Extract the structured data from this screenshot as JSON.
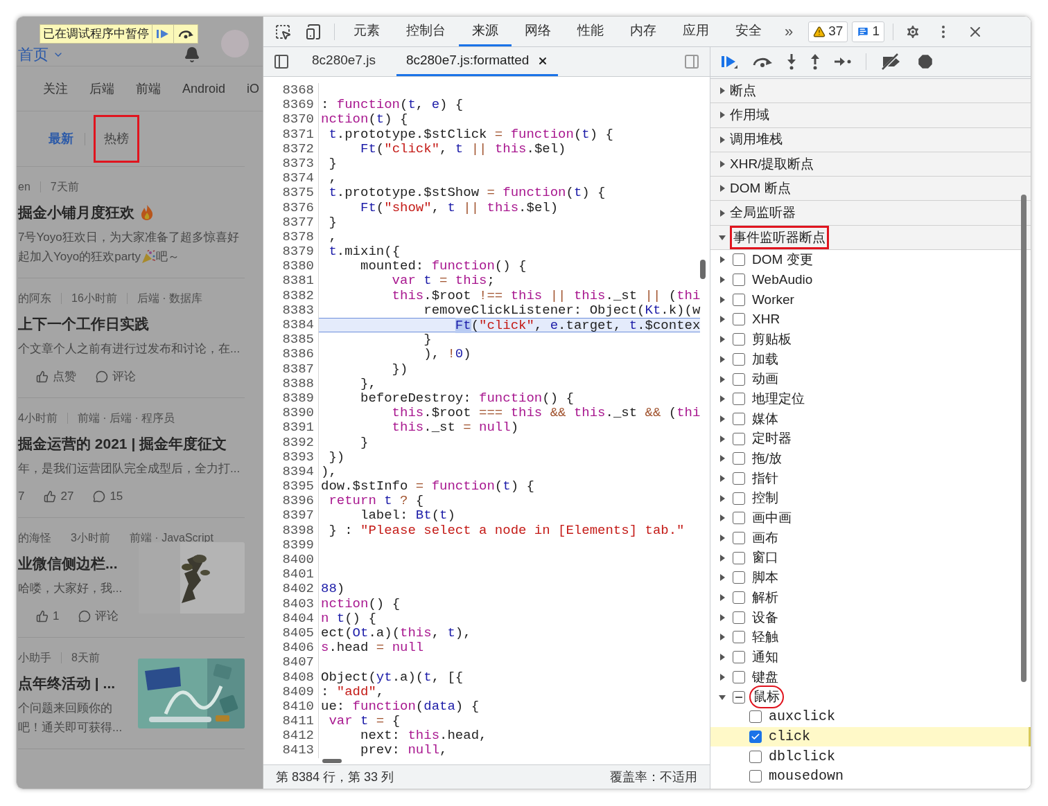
{
  "page": {
    "paused_banner": {
      "text": "已在调试程序中暂停"
    },
    "home": "首页",
    "nav": [
      "关注",
      "后端",
      "前端",
      "Android",
      "iO"
    ],
    "tabs": [
      {
        "label": "最新",
        "selected": true,
        "annotated": false
      },
      {
        "label": "热榜",
        "selected": false,
        "annotated": true
      }
    ],
    "articles": [
      {
        "meta": [
          "en",
          "7天前"
        ],
        "title": "掘金小铺月度狂欢",
        "title_emoji": true,
        "thumbnail": false,
        "lines": [
          [
            {
              "kind": "text",
              "text": "7号Yoyo狂欢日，为大家准备了超多惊喜好"
            }
          ],
          [
            {
              "kind": "text",
              "text": "起加入Yoyo的狂欢party"
            },
            {
              "kind": "party-icon"
            },
            {
              "kind": "text",
              "text": "吧～"
            }
          ]
        ]
      },
      {
        "meta": [
          "的阿东",
          "16小时前",
          "后端 · 数据库"
        ],
        "title": "上下一个工作日实践",
        "title_emoji": false,
        "thumbnail": false,
        "lines": [
          [
            {
              "kind": "text",
              "text": "个文章个人之前有进行过发布和讨论，在..."
            }
          ]
        ],
        "stats": [
          {
            "kind": "like",
            "label": "点赞"
          },
          {
            "kind": "comment",
            "label": "评论"
          }
        ]
      },
      {
        "meta": [
          "4小时前",
          "前端 · 后端 · 程序员"
        ],
        "title": "掘金运营的 2021 | 掘金年度征文",
        "title_emoji": false,
        "thumbnail": false,
        "lines": [
          [
            {
              "kind": "text",
              "text": "年，是我们运营团队完全成型后，全力打..."
            }
          ]
        ],
        "stats": [
          {
            "kind": "plain",
            "label": "7"
          },
          {
            "kind": "like",
            "label": "27"
          },
          {
            "kind": "comment",
            "label": "15"
          }
        ]
      },
      {
        "meta": [
          "的海怪",
          "3小时前",
          "前端 · JavaScript"
        ],
        "title": "业微信侧边栏...",
        "title_emoji": false,
        "thumbnail": true,
        "lines": [
          [
            {
              "kind": "text",
              "text": "哈喽，大家好，我..."
            }
          ]
        ],
        "stats": [
          {
            "kind": "like",
            "label": "1"
          },
          {
            "kind": "comment",
            "label": "评论"
          }
        ]
      },
      {
        "meta": [
          "小助手",
          "8天前"
        ],
        "title": "点年终活动 | ...",
        "title_emoji": false,
        "thumbnail": true,
        "lines": [
          [
            {
              "kind": "text",
              "text": "个问题来回顾你的"
            }
          ],
          [
            {
              "kind": "text",
              "text": "吧！通关即可获得..."
            }
          ]
        ]
      }
    ]
  },
  "devtools": {
    "tabs": [
      {
        "label": "元素",
        "selected": false
      },
      {
        "label": "控制台",
        "selected": false
      },
      {
        "label": "来源",
        "selected": true
      },
      {
        "label": "网络",
        "selected": false
      },
      {
        "label": "性能",
        "selected": false
      },
      {
        "label": "内存",
        "selected": false
      },
      {
        "label": "应用",
        "selected": false
      },
      {
        "label": "安全",
        "selected": false
      }
    ],
    "more": "»",
    "warnings": "37",
    "messages": "1",
    "files": [
      {
        "label": "8c280e7.js",
        "selected": false,
        "closable": false
      },
      {
        "label": "8c280e7.js:formatted",
        "selected": true,
        "closable": true
      }
    ],
    "code": [
      {
        "number": "8368",
        "current": false
      },
      {
        "number": "8369",
        "current": false,
        "tokens": [
          {
            "kind": "p",
            "text": ":"
          },
          {
            "kind": "kw",
            "text": " function"
          },
          {
            "kind": "p",
            "text": "("
          },
          {
            "kind": "name",
            "text": "t"
          },
          {
            "kind": "p",
            "text": ","
          },
          {
            "kind": "name",
            "text": " e"
          },
          {
            "kind": "p",
            "text": ") {"
          }
        ]
      },
      {
        "number": "8370",
        "current": false,
        "tokens": [
          {
            "kind": "kw",
            "text": "nction"
          },
          {
            "kind": "p",
            "text": "("
          },
          {
            "kind": "name",
            "text": "t"
          },
          {
            "kind": "p",
            "text": ") {"
          }
        ]
      },
      {
        "number": "8371",
        "current": false,
        "tokens": [
          {
            "kind": "name",
            "text": " t"
          },
          {
            "kind": "p",
            "text": ".prototype.$stClick"
          },
          {
            "kind": "op",
            "text": " ="
          },
          {
            "kind": "kw",
            "text": " function"
          },
          {
            "kind": "p",
            "text": "("
          },
          {
            "kind": "name",
            "text": "t"
          },
          {
            "kind": "p",
            "text": ") {"
          }
        ]
      },
      {
        "number": "8372",
        "current": false,
        "tokens": [
          {
            "kind": "name",
            "text": "     Ft"
          },
          {
            "kind": "p",
            "text": "("
          },
          {
            "kind": "str",
            "text": "\"click\""
          },
          {
            "kind": "p",
            "text": ","
          },
          {
            "kind": "name",
            "text": " t"
          },
          {
            "kind": "op",
            "text": " ||"
          },
          {
            "kind": "kw",
            "text": " this"
          },
          {
            "kind": "p",
            "text": ".$el)"
          }
        ]
      },
      {
        "number": "8373",
        "current": false,
        "tokens": [
          {
            "kind": "p",
            "text": " }"
          }
        ]
      },
      {
        "number": "8374",
        "current": false,
        "tokens": [
          {
            "kind": "p",
            "text": " ,"
          }
        ]
      },
      {
        "number": "8375",
        "current": false,
        "tokens": [
          {
            "kind": "name",
            "text": " t"
          },
          {
            "kind": "p",
            "text": ".prototype.$stShow"
          },
          {
            "kind": "op",
            "text": " ="
          },
          {
            "kind": "kw",
            "text": " function"
          },
          {
            "kind": "p",
            "text": "("
          },
          {
            "kind": "name",
            "text": "t"
          },
          {
            "kind": "p",
            "text": ") {"
          }
        ]
      },
      {
        "number": "8376",
        "current": false,
        "tokens": [
          {
            "kind": "name",
            "text": "     Ft"
          },
          {
            "kind": "p",
            "text": "("
          },
          {
            "kind": "str",
            "text": "\"show\""
          },
          {
            "kind": "p",
            "text": ","
          },
          {
            "kind": "name",
            "text": " t"
          },
          {
            "kind": "op",
            "text": " ||"
          },
          {
            "kind": "kw",
            "text": " this"
          },
          {
            "kind": "p",
            "text": ".$el)"
          }
        ]
      },
      {
        "number": "8377",
        "current": false,
        "tokens": [
          {
            "kind": "p",
            "text": " }"
          }
        ]
      },
      {
        "number": "8378",
        "current": false,
        "tokens": [
          {
            "kind": "p",
            "text": " ,"
          }
        ]
      },
      {
        "number": "8379",
        "current": false,
        "tokens": [
          {
            "kind": "name",
            "text": " t"
          },
          {
            "kind": "p",
            "text": ".mixin({"
          }
        ]
      },
      {
        "number": "8380",
        "current": false,
        "tokens": [
          {
            "kind": "p",
            "text": "     mounted:"
          },
          {
            "kind": "kw",
            "text": " function"
          },
          {
            "kind": "p",
            "text": "() {"
          }
        ]
      },
      {
        "number": "8381",
        "current": false,
        "tokens": [
          {
            "kind": "kw",
            "text": "         var"
          },
          {
            "kind": "name",
            "text": " t"
          },
          {
            "kind": "op",
            "text": " ="
          },
          {
            "kind": "kw",
            "text": " this"
          },
          {
            "kind": "p",
            "text": ";"
          }
        ]
      },
      {
        "number": "8382",
        "current": false,
        "tokens": [
          {
            "kind": "kw",
            "text": "         this"
          },
          {
            "kind": "p",
            "text": ".$root"
          },
          {
            "kind": "op",
            "text": " !=="
          },
          {
            "kind": "kw",
            "text": " this"
          },
          {
            "kind": "op",
            "text": " ||"
          },
          {
            "kind": "kw",
            "text": " this"
          },
          {
            "kind": "p",
            "text": "._st"
          },
          {
            "kind": "op",
            "text": " ||"
          },
          {
            "kind": "p",
            "text": " ("
          },
          {
            "kind": "kw",
            "text": "thi"
          }
        ]
      },
      {
        "number": "8383",
        "current": false,
        "tokens": [
          {
            "kind": "p",
            "text": "             removeClickListener: Object("
          },
          {
            "kind": "name",
            "text": "Kt"
          },
          {
            "kind": "p",
            "text": ".k)(w"
          }
        ]
      },
      {
        "number": "8384",
        "current": true,
        "tokens": [
          {
            "kind": "match",
            "text": "                 Ft"
          },
          {
            "kind": "p",
            "text": "("
          },
          {
            "kind": "str",
            "text": "\"click\""
          },
          {
            "kind": "p",
            "text": ","
          },
          {
            "kind": "name",
            "text": " e"
          },
          {
            "kind": "p",
            "text": ".target,"
          },
          {
            "kind": "name",
            "text": " t"
          },
          {
            "kind": "p",
            "text": ".$contex"
          }
        ]
      },
      {
        "number": "8385",
        "current": false,
        "tokens": [
          {
            "kind": "p",
            "text": "             }"
          }
        ]
      },
      {
        "number": "8386",
        "current": false,
        "tokens": [
          {
            "kind": "p",
            "text": "             ),"
          },
          {
            "kind": "op",
            "text": " !"
          },
          {
            "kind": "name",
            "text": "0"
          },
          {
            "kind": "p",
            "text": ")"
          }
        ]
      },
      {
        "number": "8387",
        "current": false,
        "tokens": [
          {
            "kind": "p",
            "text": "         })"
          }
        ]
      },
      {
        "number": "8388",
        "current": false,
        "tokens": [
          {
            "kind": "p",
            "text": "     },"
          }
        ]
      },
      {
        "number": "8389",
        "current": false,
        "tokens": [
          {
            "kind": "p",
            "text": "     beforeDestroy:"
          },
          {
            "kind": "kw",
            "text": " function"
          },
          {
            "kind": "p",
            "text": "() {"
          }
        ]
      },
      {
        "number": "8390",
        "current": false,
        "tokens": [
          {
            "kind": "kw",
            "text": "         this"
          },
          {
            "kind": "p",
            "text": ".$root"
          },
          {
            "kind": "op",
            "text": " ==="
          },
          {
            "kind": "kw",
            "text": " this"
          },
          {
            "kind": "op",
            "text": " &&"
          },
          {
            "kind": "kw",
            "text": " this"
          },
          {
            "kind": "p",
            "text": "._st"
          },
          {
            "kind": "op",
            "text": " &&"
          },
          {
            "kind": "p",
            "text": " ("
          },
          {
            "kind": "kw",
            "text": "thi"
          }
        ]
      },
      {
        "number": "8391",
        "current": false,
        "tokens": [
          {
            "kind": "kw",
            "text": "         this"
          },
          {
            "kind": "p",
            "text": "._st"
          },
          {
            "kind": "op",
            "text": " ="
          },
          {
            "kind": "kw",
            "text": " null"
          },
          {
            "kind": "p",
            "text": ")"
          }
        ]
      },
      {
        "number": "8392",
        "current": false,
        "tokens": [
          {
            "kind": "p",
            "text": "     }"
          }
        ]
      },
      {
        "number": "8393",
        "current": false,
        "tokens": [
          {
            "kind": "p",
            "text": " })"
          }
        ]
      },
      {
        "number": "8394",
        "current": false,
        "tokens": [
          {
            "kind": "p",
            "text": "),"
          }
        ]
      },
      {
        "number": "8395",
        "current": false,
        "tokens": [
          {
            "kind": "p",
            "text": "dow.$stInfo"
          },
          {
            "kind": "op",
            "text": " ="
          },
          {
            "kind": "kw",
            "text": " function"
          },
          {
            "kind": "p",
            "text": "("
          },
          {
            "kind": "name",
            "text": "t"
          },
          {
            "kind": "p",
            "text": ") {"
          }
        ]
      },
      {
        "number": "8396",
        "current": false,
        "tokens": [
          {
            "kind": "kw",
            "text": " return"
          },
          {
            "kind": "name",
            "text": " t"
          },
          {
            "kind": "op",
            "text": " ?"
          },
          {
            "kind": "p",
            "text": " {"
          }
        ]
      },
      {
        "number": "8397",
        "current": false,
        "tokens": [
          {
            "kind": "p",
            "text": "     label:"
          },
          {
            "kind": "name",
            "text": " Bt"
          },
          {
            "kind": "p",
            "text": "("
          },
          {
            "kind": "name",
            "text": "t"
          },
          {
            "kind": "p",
            "text": ")"
          }
        ]
      },
      {
        "number": "8398",
        "current": false,
        "tokens": [
          {
            "kind": "p",
            "text": " } :"
          },
          {
            "kind": "str",
            "text": " \"Please select a node in [Elements] tab.\""
          }
        ]
      },
      {
        "number": "8399",
        "current": false
      },
      {
        "number": "8400",
        "current": false
      },
      {
        "number": "8401",
        "current": false
      },
      {
        "number": "8402",
        "current": false,
        "tokens": [
          {
            "kind": "name",
            "text": "88"
          },
          {
            "kind": "p",
            "text": ")"
          }
        ]
      },
      {
        "number": "8403",
        "current": false,
        "tokens": [
          {
            "kind": "kw",
            "text": "nction"
          },
          {
            "kind": "p",
            "text": "() {"
          }
        ]
      },
      {
        "number": "8404",
        "current": false,
        "tokens": [
          {
            "kind": "kw",
            "text": "n"
          },
          {
            "kind": "name",
            "text": " t"
          },
          {
            "kind": "p",
            "text": "() {"
          }
        ]
      },
      {
        "number": "8405",
        "current": false,
        "tokens": [
          {
            "kind": "p",
            "text": "ect("
          },
          {
            "kind": "name",
            "text": "Ot"
          },
          {
            "kind": "p",
            "text": ".a)("
          },
          {
            "kind": "kw",
            "text": "this"
          },
          {
            "kind": "p",
            "text": ","
          },
          {
            "kind": "name",
            "text": " t"
          },
          {
            "kind": "p",
            "text": "),"
          }
        ]
      },
      {
        "number": "8406",
        "current": false,
        "tokens": [
          {
            "kind": "kw",
            "text": "s"
          },
          {
            "kind": "p",
            "text": ".head"
          },
          {
            "kind": "op",
            "text": " ="
          },
          {
            "kind": "kw",
            "text": " null"
          }
        ]
      },
      {
        "number": "8407",
        "current": false
      },
      {
        "number": "8408",
        "current": false,
        "tokens": [
          {
            "kind": "p",
            "text": "Object("
          },
          {
            "kind": "name",
            "text": "yt"
          },
          {
            "kind": "p",
            "text": ".a)("
          },
          {
            "kind": "name",
            "text": "t"
          },
          {
            "kind": "p",
            "text": ", [{"
          }
        ]
      },
      {
        "number": "8409",
        "current": false,
        "tokens": [
          {
            "kind": "p",
            "text": ":"
          },
          {
            "kind": "str",
            "text": " \"add\""
          },
          {
            "kind": "p",
            "text": ","
          }
        ]
      },
      {
        "number": "8410",
        "current": false,
        "tokens": [
          {
            "kind": "p",
            "text": "ue:"
          },
          {
            "kind": "kw",
            "text": " function"
          },
          {
            "kind": "p",
            "text": "("
          },
          {
            "kind": "name",
            "text": "data"
          },
          {
            "kind": "p",
            "text": ") {"
          }
        ]
      },
      {
        "number": "8411",
        "current": false,
        "tokens": [
          {
            "kind": "kw",
            "text": " var"
          },
          {
            "kind": "name",
            "text": " t"
          },
          {
            "kind": "op",
            "text": " ="
          },
          {
            "kind": "p",
            "text": " {"
          }
        ]
      },
      {
        "number": "8412",
        "current": false,
        "tokens": [
          {
            "kind": "p",
            "text": "     next:"
          },
          {
            "kind": "kw",
            "text": " this"
          },
          {
            "kind": "p",
            "text": ".head,"
          }
        ]
      },
      {
        "number": "8413",
        "current": false,
        "tokens": [
          {
            "kind": "p",
            "text": "     prev:"
          },
          {
            "kind": "kw",
            "text": " null"
          },
          {
            "kind": "p",
            "text": ","
          }
        ]
      }
    ],
    "status_bar": {
      "position": "第 8384 行，第 33 列",
      "coverage": "覆盖率：不适用"
    },
    "sections": [
      {
        "label": "断点",
        "expanded": false,
        "annotated": false
      },
      {
        "label": "作用域",
        "expanded": false,
        "annotated": false
      },
      {
        "label": "调用堆栈",
        "expanded": false,
        "annotated": false
      },
      {
        "label": "XHR/提取断点",
        "expanded": false,
        "annotated": false
      },
      {
        "label": "DOM 断点",
        "expanded": false,
        "annotated": false
      },
      {
        "label": "全局监听器",
        "expanded": false,
        "annotated": false
      },
      {
        "label": "事件监听器断点",
        "expanded": true,
        "annotated": true
      }
    ],
    "event_categories": [
      {
        "label": "DOM 变更",
        "expanded": false,
        "checked": false,
        "indeterminate": false,
        "annotated": false
      },
      {
        "label": "WebAudio",
        "expanded": false,
        "checked": false,
        "indeterminate": false,
        "annotated": false
      },
      {
        "label": "Worker",
        "expanded": false,
        "checked": false,
        "indeterminate": false,
        "annotated": false
      },
      {
        "label": "XHR",
        "expanded": false,
        "checked": false,
        "indeterminate": false,
        "annotated": false
      },
      {
        "label": "剪贴板",
        "expanded": false,
        "checked": false,
        "indeterminate": false,
        "annotated": false
      },
      {
        "label": "加载",
        "expanded": false,
        "checked": false,
        "indeterminate": false,
        "annotated": false
      },
      {
        "label": "动画",
        "expanded": false,
        "checked": false,
        "indeterminate": false,
        "annotated": false
      },
      {
        "label": "地理定位",
        "expanded": false,
        "checked": false,
        "indeterminate": false,
        "annotated": false
      },
      {
        "label": "媒体",
        "expanded": false,
        "checked": false,
        "indeterminate": false,
        "annotated": false
      },
      {
        "label": "定时器",
        "expanded": false,
        "checked": false,
        "indeterminate": false,
        "annotated": false
      },
      {
        "label": "拖/放",
        "expanded": false,
        "checked": false,
        "indeterminate": false,
        "annotated": false
      },
      {
        "label": "指针",
        "expanded": false,
        "checked": false,
        "indeterminate": false,
        "annotated": false
      },
      {
        "label": "控制",
        "expanded": false,
        "checked": false,
        "indeterminate": false,
        "annotated": false
      },
      {
        "label": "画中画",
        "expanded": false,
        "checked": false,
        "indeterminate": false,
        "annotated": false
      },
      {
        "label": "画布",
        "expanded": false,
        "checked": false,
        "indeterminate": false,
        "annotated": false
      },
      {
        "label": "窗口",
        "expanded": false,
        "checked": false,
        "indeterminate": false,
        "annotated": false
      },
      {
        "label": "脚本",
        "expanded": false,
        "checked": false,
        "indeterminate": false,
        "annotated": false
      },
      {
        "label": "解析",
        "expanded": false,
        "checked": false,
        "indeterminate": false,
        "annotated": false
      },
      {
        "label": "设备",
        "expanded": false,
        "checked": false,
        "indeterminate": false,
        "annotated": false
      },
      {
        "label": "轻触",
        "expanded": false,
        "checked": false,
        "indeterminate": false,
        "annotated": false
      },
      {
        "label": "通知",
        "expanded": false,
        "checked": false,
        "indeterminate": false,
        "annotated": false
      },
      {
        "label": "键盘",
        "expanded": false,
        "checked": false,
        "indeterminate": false,
        "annotated": false
      },
      {
        "label": "鼠标",
        "expanded": true,
        "checked": false,
        "indeterminate": true,
        "annotated": true,
        "children": [
          {
            "label": "auxclick",
            "checked": false,
            "selected": false
          },
          {
            "label": "click",
            "checked": true,
            "selected": true
          },
          {
            "label": "dblclick",
            "checked": false,
            "selected": false
          },
          {
            "label": "mousedown",
            "checked": false,
            "selected": false
          }
        ]
      }
    ]
  }
}
